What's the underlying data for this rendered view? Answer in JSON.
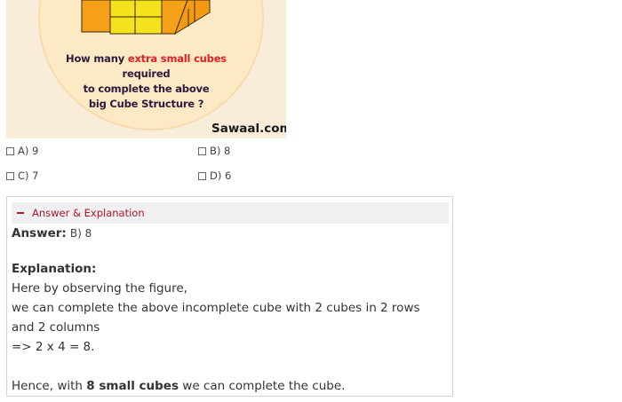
{
  "puzzle": {
    "question_part1": "How many ",
    "question_highlight": "extra small cubes",
    "question_part2": " required",
    "question_line2": "to complete the above",
    "question_line3": "big Cube Structure ?",
    "brand": "Sawaal.com",
    "colors": {
      "background": "#f9ecd9",
      "circle": "#fde9c4",
      "cube_orange": "#f5a017",
      "cube_yellow": "#f3e21d",
      "highlight": "#e0202a"
    }
  },
  "options": [
    {
      "label": "A) 9"
    },
    {
      "label": "B) 8"
    },
    {
      "label": "C) 7"
    },
    {
      "label": "D) 6"
    }
  ],
  "answer": {
    "toggle_label": "Answer & Explanation",
    "answer_label": "Answer:",
    "answer_value": "B) 8",
    "explanation_label": "Explanation:",
    "lines": [
      "Here by observing the figure,",
      "we can complete the above incomplete cube with 2 cubes in 2 rows",
      "and 2 columns",
      "=> 2 x 4 = 8."
    ],
    "conclusion_pre": "Hence, with ",
    "conclusion_bold": "8 small cubes",
    "conclusion_post": " we can complete the cube."
  }
}
